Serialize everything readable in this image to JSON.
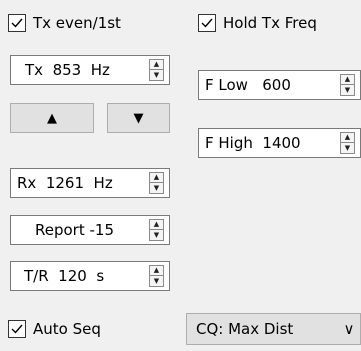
{
  "checkboxes": {
    "tx_even": {
      "label": "Tx even/1st",
      "checked": true
    },
    "hold_tx_freq": {
      "label": "Hold Tx Freq",
      "checked": true
    },
    "auto_seq": {
      "label": "Auto Seq",
      "checked": true
    }
  },
  "spinboxes": {
    "tx_freq": "Tx  853  Hz",
    "rx_freq": "Rx  1261  Hz",
    "report": "Report -15",
    "tr_period": "T/R  120  s",
    "f_low": "F Low   600",
    "f_high": "F High  1400"
  },
  "buttons": {
    "up_symbol": "▲",
    "down_symbol": "▼"
  },
  "combo": {
    "cq_mode": "CQ: Max Dist",
    "arrow": "∨"
  }
}
